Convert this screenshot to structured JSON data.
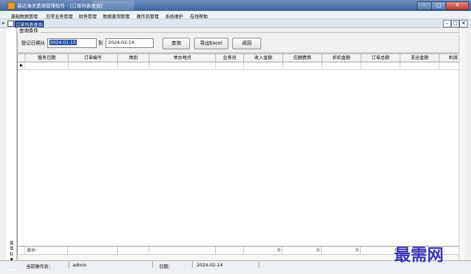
{
  "window": {
    "title": "易达海关费用管理软件 - [订单列表查询]",
    "min_glyph": "–",
    "max_glyph": "□",
    "close_glyph": "✕"
  },
  "menu": [
    "基础数据管理",
    "日常业务管理",
    "财务管理",
    "数据查询管理",
    "操作员管理",
    "系统维护",
    "在线帮助"
  ],
  "mdi": {
    "arrow": "»",
    "title": "订单列表查询"
  },
  "query": {
    "group_label": "查询条件",
    "date_label": "登记日期从",
    "date_from": "2024-01-15",
    "to_label": "到",
    "date_to": "2024-02-14",
    "btn_search": "查询",
    "btn_export": "导出Excel",
    "btn_back": "返回"
  },
  "table": {
    "columns": [
      "服务日期",
      "订单编号",
      "类别",
      "举办地点",
      "业务员",
      "收入金额",
      "应酬费用",
      "折扣金额",
      "订单总额",
      "支出金额",
      "利润"
    ],
    "row_marker": "▶",
    "footer_label": "合计:",
    "totals": [
      "0",
      "0",
      "0",
      "0"
    ]
  },
  "leftbar": [
    "菜",
    "单",
    "栏",
    "▼"
  ],
  "status": {
    "operator_label": "当前操作员：",
    "operator": "admin",
    "date_label": "日期：",
    "date": "2024-02-14"
  },
  "watermark": "最需网"
}
